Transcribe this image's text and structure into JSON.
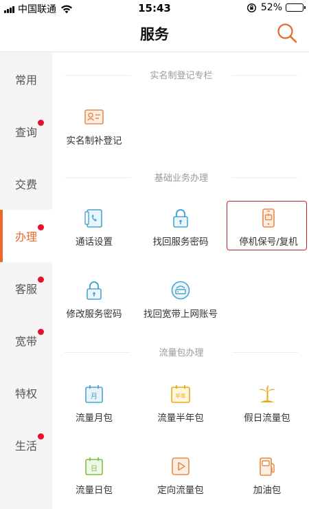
{
  "status_bar": {
    "carrier": "中国联通",
    "time": "15:43",
    "battery_percent": "52%",
    "battery_level": 0.52
  },
  "header": {
    "title": "服务"
  },
  "colors": {
    "accent": "#e96a2b",
    "dot": "#e8102a",
    "highlight": "#c9262b"
  },
  "sidebar": {
    "items": [
      {
        "label": "常用",
        "dot": false,
        "active": false
      },
      {
        "label": "查询",
        "dot": true,
        "active": false
      },
      {
        "label": "交费",
        "dot": false,
        "active": false
      },
      {
        "label": "办理",
        "dot": true,
        "active": true
      },
      {
        "label": "客服",
        "dot": true,
        "active": false
      },
      {
        "label": "宽带",
        "dot": true,
        "active": false
      },
      {
        "label": "特权",
        "dot": false,
        "active": false
      },
      {
        "label": "生活",
        "dot": true,
        "active": false
      }
    ]
  },
  "sections": [
    {
      "title": "实名制登记专栏",
      "items": [
        {
          "label": "实名制补登记",
          "icon": "id-card-icon"
        }
      ]
    },
    {
      "title": "基础业务办理",
      "items": [
        {
          "label": "通话设置",
          "icon": "call-settings-icon"
        },
        {
          "label": "找回服务密码",
          "icon": "lock-icon"
        },
        {
          "label": "停机保号/复机",
          "icon": "phone-icon",
          "highlighted": true
        },
        {
          "label": "修改服务密码",
          "icon": "lock-icon"
        },
        {
          "label": "找回宽带上网账号",
          "icon": "router-icon"
        }
      ]
    },
    {
      "title": "流量包办理",
      "items": [
        {
          "label": "流量月包",
          "icon": "calendar-month-icon",
          "badge": "月"
        },
        {
          "label": "流量半年包",
          "icon": "calendar-halfyear-icon",
          "badge": "半年"
        },
        {
          "label": "假日流量包",
          "icon": "palm-tree-icon"
        },
        {
          "label": "流量日包",
          "icon": "calendar-day-icon",
          "badge": "日"
        },
        {
          "label": "定向流量包",
          "icon": "video-play-icon"
        },
        {
          "label": "加油包",
          "icon": "fuel-pump-icon"
        }
      ]
    }
  ]
}
